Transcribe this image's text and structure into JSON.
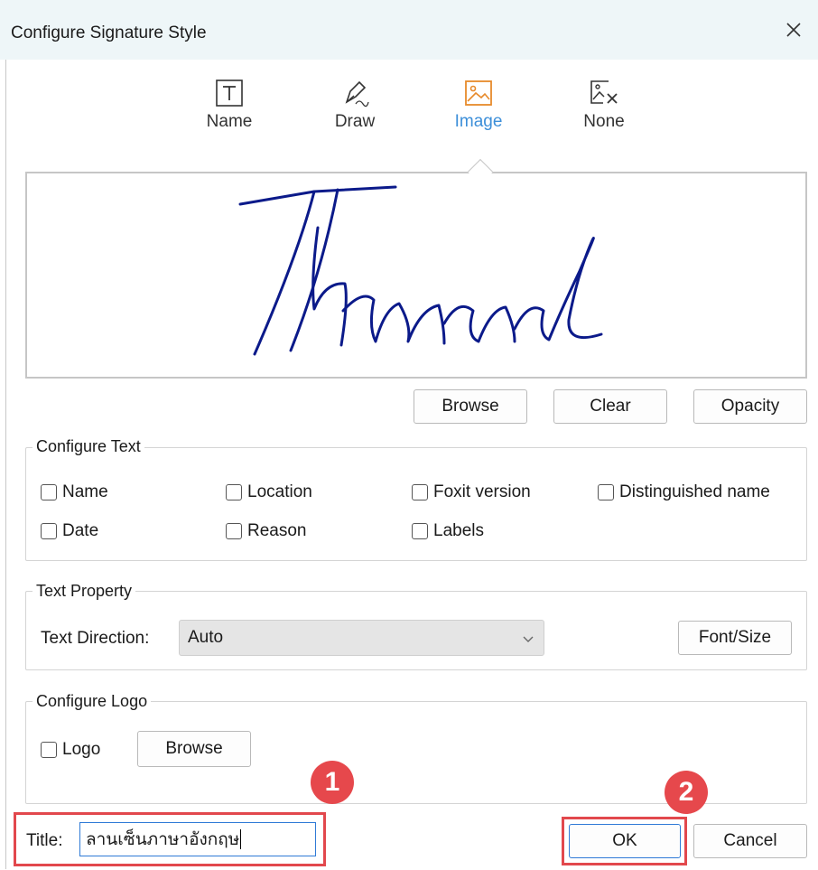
{
  "dialog": {
    "title": "Configure Signature Style"
  },
  "tabs": [
    {
      "label": "Name",
      "icon": "text-box-icon",
      "active": false
    },
    {
      "label": "Draw",
      "icon": "pen-icon",
      "active": false
    },
    {
      "label": "Image",
      "icon": "image-icon",
      "active": true
    },
    {
      "label": "None",
      "icon": "no-image-icon",
      "active": false
    }
  ],
  "preview_buttons": {
    "browse": "Browse",
    "clear": "Clear",
    "opacity": "Opacity"
  },
  "configure_text": {
    "label": "Configure Text",
    "options": [
      {
        "label": "Name",
        "checked": false
      },
      {
        "label": "Location",
        "checked": false
      },
      {
        "label": "Foxit version",
        "checked": false
      },
      {
        "label": "Distinguished name",
        "checked": false
      },
      {
        "label": "Date",
        "checked": false
      },
      {
        "label": "Reason",
        "checked": false
      },
      {
        "label": "Labels",
        "checked": false
      }
    ]
  },
  "text_property": {
    "label": "Text Property",
    "direction_label": "Text Direction:",
    "direction_value": "Auto",
    "font_button": "Font/Size"
  },
  "configure_logo": {
    "label": "Configure Logo",
    "logo_label": "Logo",
    "logo_checked": false,
    "browse": "Browse"
  },
  "footer": {
    "title_label": "Title:",
    "title_value": "ลานเซ็นภาษาอังกฤษ",
    "ok": "OK",
    "cancel": "Cancel"
  },
  "annotations": {
    "badge1": "1",
    "badge2": "2"
  },
  "colors": {
    "accent": "#3d8fd9",
    "highlight": "#e2484d",
    "ink": "#0b1a8a"
  }
}
